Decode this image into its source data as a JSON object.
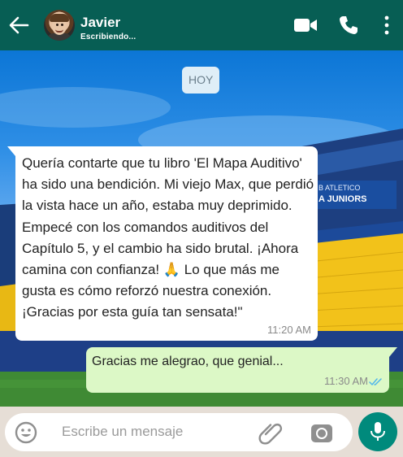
{
  "header": {
    "contact_name": "Javier",
    "status": "Escribiendo...",
    "icons": [
      "back-arrow-icon",
      "video-call-icon",
      "phone-icon",
      "more-options-icon"
    ]
  },
  "chat": {
    "day_label": "HOY",
    "messages": [
      {
        "direction": "incoming",
        "text": "Quería contarte que tu libro 'El Mapa Auditivo' ha sido una bendición. Mi viejo Max, que perdió la vista hace un año, estaba muy deprimido. Empecé con los comandos auditivos del Capítulo 5, y el cambio ha sido brutal. ¡Ahora camina con confianza! 🙏 Lo que más me gusta es cómo reforzó nuestra conexión. ¡Gracias por esta guía tan sensata!\"",
        "time": "11:20 AM"
      },
      {
        "direction": "outgoing",
        "text": "Gracias me alegrao, que genial...",
        "time": "11:30 AM",
        "read_status": "double-check-icon"
      }
    ]
  },
  "composer": {
    "placeholder": "Escribe un mensaje",
    "value": "",
    "icons": [
      "emoji-icon",
      "attach-icon",
      "camera-icon",
      "mic-icon"
    ]
  },
  "background": {
    "sign_line1": "B ATLETICO",
    "sign_line2": "A JUNIORS"
  },
  "colors": {
    "header": "#075e54",
    "outgoing_bubble": "#dcf8c6",
    "mic_button": "#008a7c",
    "read_ticks": "#4fb6ec"
  }
}
